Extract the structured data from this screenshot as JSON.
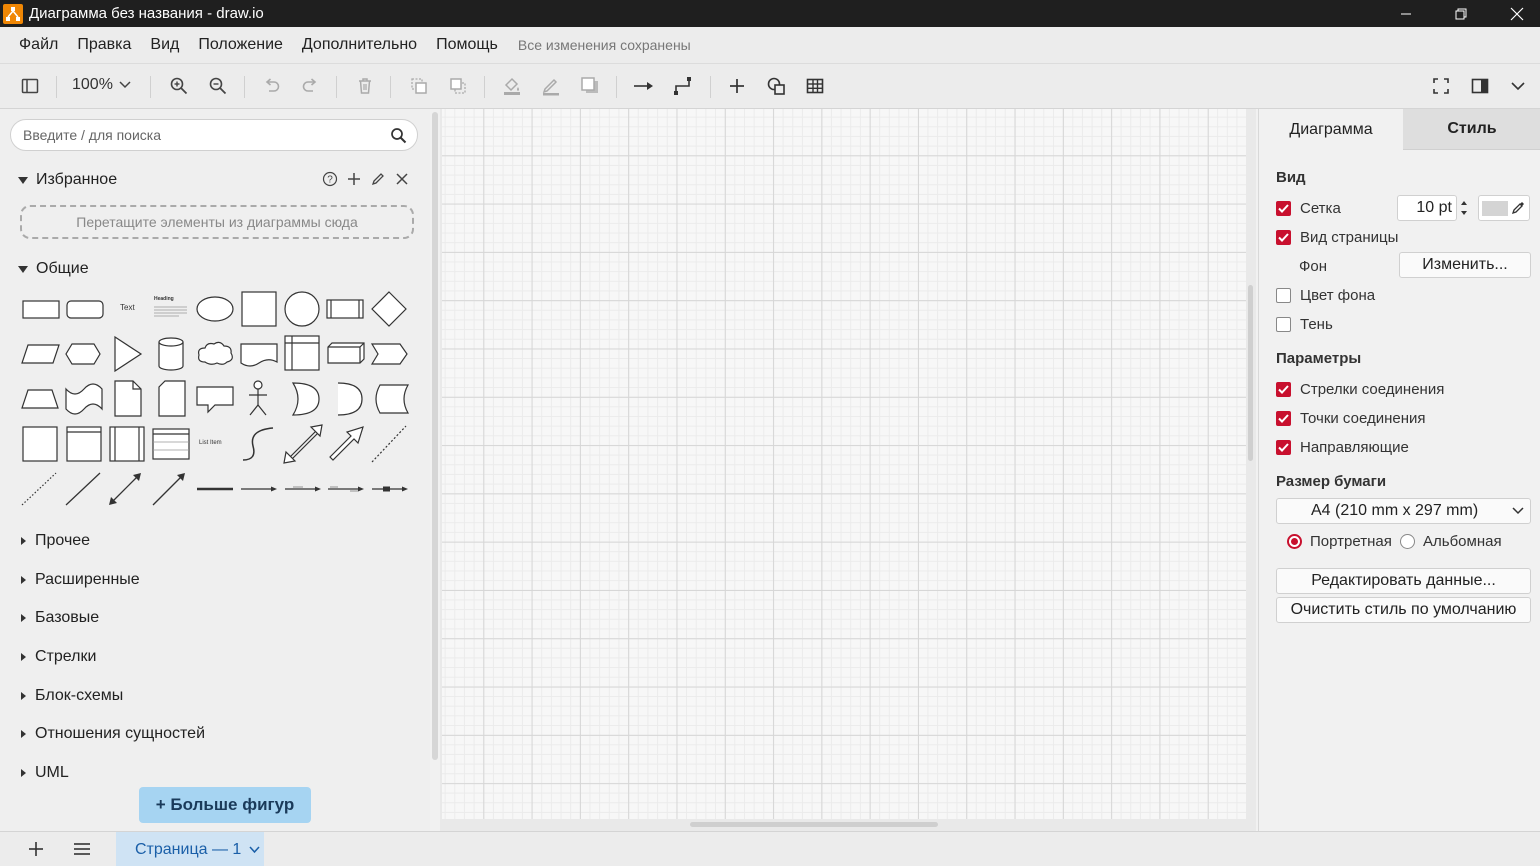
{
  "window": {
    "title": "Диаграмма без названия - draw.io",
    "icons": [
      "drawio-logo-icon",
      "minimize-icon",
      "restore-icon",
      "close-icon"
    ]
  },
  "menubar": {
    "items": [
      "Файл",
      "Правка",
      "Вид",
      "Положение",
      "Дополнительно",
      "Помощь"
    ],
    "status": "Все изменения сохранены"
  },
  "toolbar": {
    "zoom": "100%",
    "icons": [
      "sidebar-toggle-icon",
      "zoom-in-icon",
      "zoom-out-icon",
      "undo-icon",
      "redo-icon",
      "delete-icon",
      "to-front-icon",
      "to-back-icon",
      "fill-color-icon",
      "line-color-icon",
      "shadow-icon",
      "connection-icon",
      "waypoints-icon",
      "insert-icon",
      "shapes-icon",
      "table-icon",
      "fullscreen-icon",
      "format-panel-icon",
      "collapse-icon"
    ]
  },
  "sidebar": {
    "search_placeholder": "Введите / для поиска",
    "favorites": {
      "title": "Избранное",
      "dropzone": "Перетащите элементы из диаграммы сюда",
      "actions": [
        "help-icon",
        "add-icon",
        "edit-icon",
        "close-icon"
      ]
    },
    "general": {
      "title": "Общие",
      "text_shape_label": "Text",
      "heading_shape_label": "Heading",
      "list_item_label": "List Item"
    },
    "sections": [
      "Прочее",
      "Расширенные",
      "Базовые",
      "Стрелки",
      "Блок-схемы",
      "Отношения сущностей",
      "UML"
    ],
    "more_shapes": "+ Больше фигур"
  },
  "format_panel": {
    "tabs": [
      "Диаграмма",
      "Стиль"
    ],
    "view_heading": "Вид",
    "grid_label": "Сетка",
    "grid_checked": true,
    "grid_size": "10 pt",
    "grid_color": "#d4d4d4",
    "page_view_label": "Вид страницы",
    "page_view_checked": true,
    "background_label": "Фон",
    "background_button": "Изменить...",
    "bg_color_label": "Цвет фона",
    "bg_color_checked": false,
    "shadow_label": "Тень",
    "shadow_checked": false,
    "options_heading": "Параметры",
    "options": [
      {
        "label": "Стрелки соединения",
        "checked": true
      },
      {
        "label": "Точки соединения",
        "checked": true
      },
      {
        "label": "Направляющие",
        "checked": true
      }
    ],
    "paper_heading": "Размер бумаги",
    "paper_size": "A4 (210 mm x 297 mm)",
    "orientation_portrait": "Портретная",
    "orientation_landscape": "Альбомная",
    "orientation_selected": "portrait",
    "edit_data_button": "Редактировать данные...",
    "clear_style_button": "Очистить стиль по умолчанию",
    "accent_color": "#c8102e"
  },
  "bottombar": {
    "page_tab": "Страница — 1",
    "icons": [
      "add-page-icon",
      "pages-menu-icon"
    ]
  }
}
